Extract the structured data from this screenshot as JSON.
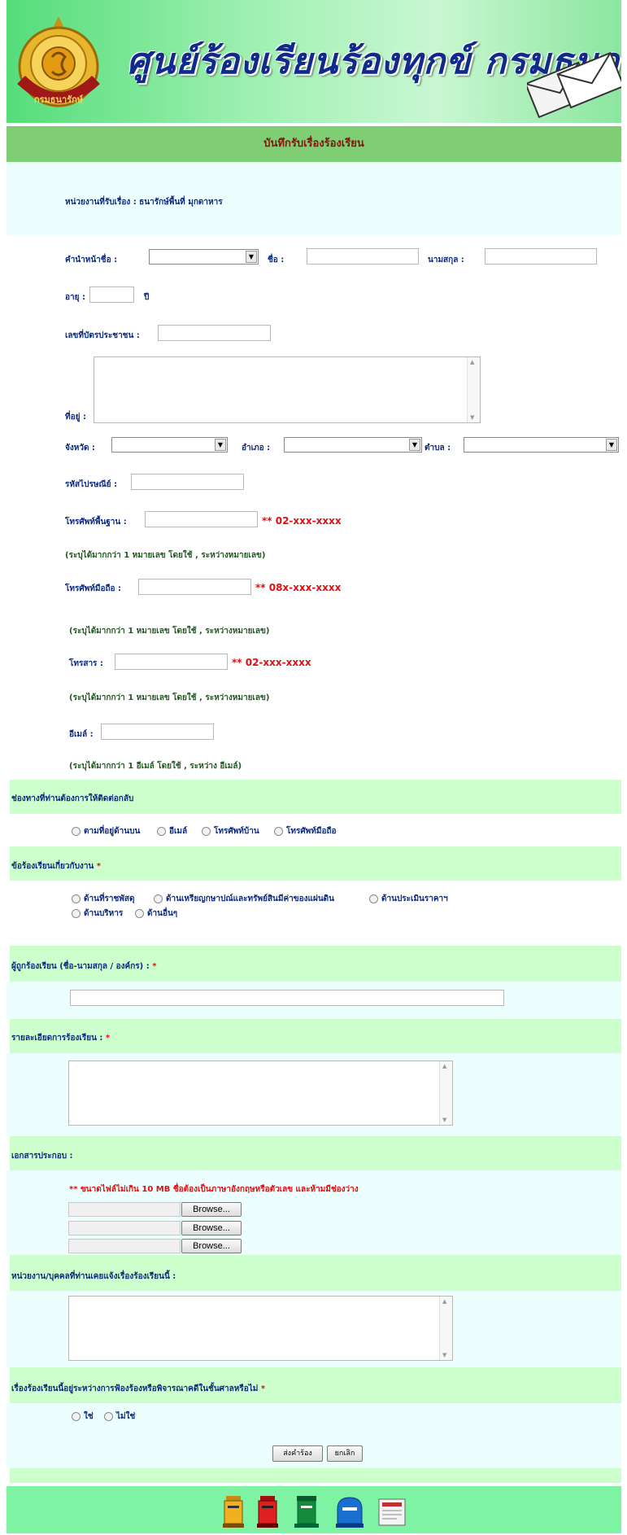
{
  "banner": {
    "title": "ศูนย์ร้องเรียนร้องทุกข์ กรมธนารักษ์",
    "seal_text": "กรมธนารักษ์",
    "seal_icon": "treasury-seal-icon",
    "envelope_icon": "envelopes-icon"
  },
  "form_title": "บันทึกรับเรื่องร้องเรียน",
  "agency": "หน่วยงานที่รับเรื่อง : ธนารักษ์พื้นที่ มุกดาหาร",
  "labels": {
    "prefix": "คำนำหน้าชื่อ :",
    "first_name": "ชื่อ :",
    "last_name": "นามสกุล :",
    "age": "อายุ :",
    "age_unit": "ปี",
    "id_card": "เลขที่บัตรประชาชน :",
    "address": "ที่อยู่ :",
    "province": "จังหวัด :",
    "district": "อำเภอ :",
    "subdistrict": "ตำบล :",
    "postcode": "รหัสไปรษณีย์ :",
    "phone": "โทรศัพท์พื้นฐาน :",
    "mobile": "โทรศัพท์มือถือ :",
    "fax": "โทรสาร :",
    "email": "อีเมล์ :"
  },
  "examples": {
    "phone": "** 02-xxx-xxxx",
    "mobile": "** 08x-xxx-xxxx",
    "fax": "** 02-xxx-xxxx"
  },
  "notes": {
    "phone": "(ระบุได้มากกว่า 1 หมายเลข โดยใช้ , ระหว่างหมายเลข)",
    "mobile": "(ระบุได้มากกว่า 1 หมายเลข โดยใช้ , ระหว่างหมายเลข)",
    "fax": "(ระบุได้มากกว่า 1 หมายเลข โดยใช้ , ระหว่างหมายเลข)",
    "email": "(ระบุได้มากกว่า 1 อีเมล์ โดยใช้ , ระหว่าง อีเมล์)"
  },
  "contact_section": {
    "title": "ช่องทางที่ท่านต้องการให้ติดต่อกลับ",
    "options": [
      "ตามที่อยู่ด้านบน",
      "อีเมล์",
      "โทรศัพท์บ้าน",
      "โทรศัพท์มือถือ"
    ]
  },
  "topic_section": {
    "title": "ข้อร้องเรียนเกี่ยวกับงาน",
    "required": "*",
    "options": [
      "ด้านที่ราชพัสดุ",
      "ด้านเหรียญกษาปณ์และทรัพย์สินมีค่าของแผ่นดิน",
      "ด้านประเมินราคาฯ",
      "ด้านบริหาร",
      "ด้านอื่นๆ"
    ]
  },
  "accused_section": {
    "title": "ผู้ถูกร้องเรียน (ชื่อ-นามสกุล / องค์กร) :",
    "required": "*"
  },
  "details_section": {
    "title": "รายละเอียดการร้องเรียน :",
    "required": "*"
  },
  "attachments_section": {
    "title": "เอกสารประกอบ :",
    "warning": "** ขนาดไฟล์ไม่เกิน 10 MB ชื่อต้องเป็นภาษาอังกฤษหรือตัวเลข และห้ามมีช่องว่าง",
    "browse_labels": [
      "Browse...",
      "Browse...",
      "Browse..."
    ]
  },
  "previous_section": {
    "title": "หน่วยงาน/บุคคลที่ท่านเคยแจ้งเรื่องร้องเรียนนี้ :"
  },
  "court_section": {
    "title": "เรื่องร้องเรียนนี้อยู่ระหว่างการฟ้องร้องหรือพิจารณาคดีในชั้นศาลหรือไม่",
    "required": "*",
    "options": [
      "ใช่",
      "ไม่ใช่"
    ]
  },
  "buttons": {
    "submit": "ส่งคำร้อง",
    "cancel": "ยกเลิก"
  },
  "footer_icons": [
    "mailbox-yellow-icon",
    "mailbox-red-icon",
    "mailbox-green-icon",
    "mailbox-blue-icon",
    "letter-icon"
  ],
  "colors": {
    "label_blue": "#0b2a80",
    "title_red": "#8b1010",
    "required_red": "#e01010",
    "header_green": "#7fce74",
    "section_green": "#ccffcc",
    "light_cyan": "#ecfefe",
    "footer_green": "#7ff3a4"
  }
}
